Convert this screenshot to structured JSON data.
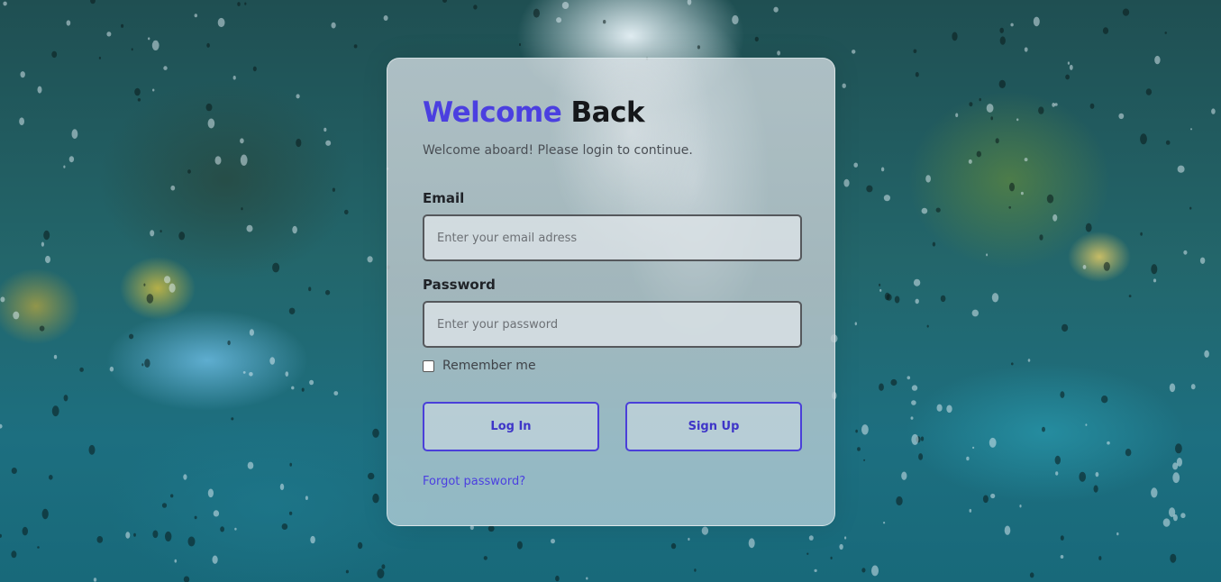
{
  "login": {
    "title_accent": "Welcome",
    "title_rest": "Back",
    "subtitle": "Welcome aboard! Please login to continue.",
    "email_label": "Email",
    "email_placeholder": "Enter your email adress",
    "email_value": "",
    "password_label": "Password",
    "password_placeholder": "Enter your password",
    "password_value": "",
    "remember_label": "Remember me",
    "remember_checked": false,
    "login_button": "Log In",
    "signup_button": "Sign Up",
    "forgot_link": "Forgot password?"
  },
  "colors": {
    "accent": "#4b3fe0",
    "heading_dark": "#15171a",
    "input_border": "#55585c"
  }
}
